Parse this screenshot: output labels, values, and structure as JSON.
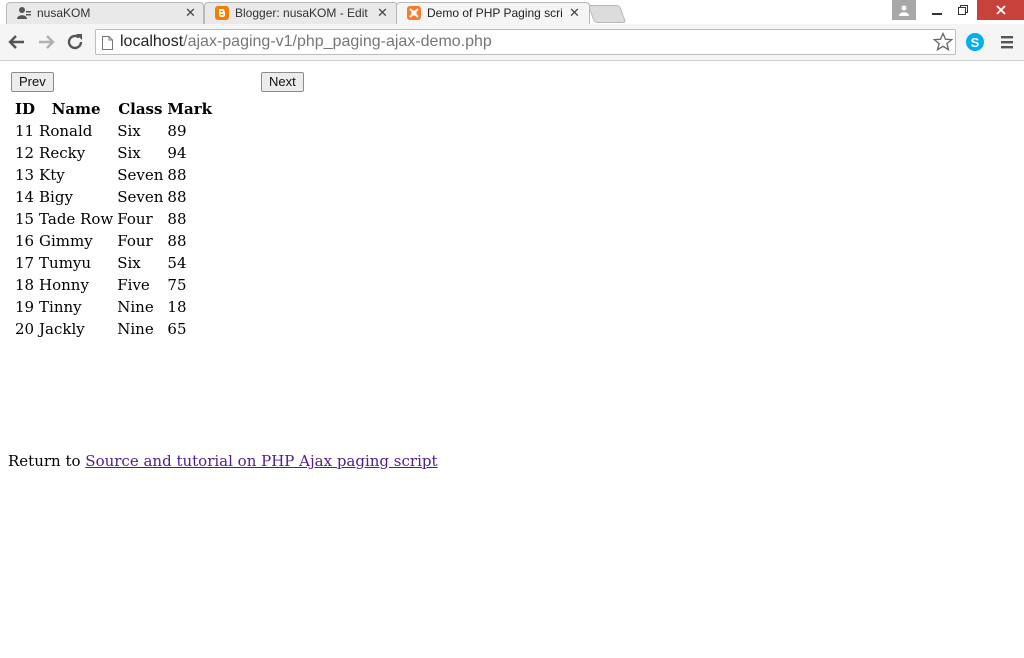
{
  "browser": {
    "tabs": [
      {
        "title": "nusaKOM",
        "icon": "user-icon"
      },
      {
        "title": "Blogger: nusaKOM - Edit e",
        "icon": "blogger-icon",
        "icon_color": "#f57d00"
      },
      {
        "title": "Demo of PHP Paging scrip",
        "icon": "xampp-icon",
        "icon_color": "#fb7a24",
        "active": true
      }
    ],
    "url_host": "localhost",
    "url_path": "/ajax-paging-v1/php_paging-ajax-demo.php"
  },
  "pager": {
    "prev_label": "Prev",
    "next_label": "Next"
  },
  "table": {
    "headers": [
      "ID",
      "Name",
      "Class",
      "Mark"
    ],
    "rows": [
      [
        "11",
        "Ronald",
        "Six",
        "89"
      ],
      [
        "12",
        "Recky",
        "Six",
        "94"
      ],
      [
        "13",
        "Kty",
        "Seven",
        "88"
      ],
      [
        "14",
        "Bigy",
        "Seven",
        "88"
      ],
      [
        "15",
        "Tade Row",
        "Four",
        "88"
      ],
      [
        "16",
        "Gimmy",
        "Four",
        "88"
      ],
      [
        "17",
        "Tumyu",
        "Six",
        "54"
      ],
      [
        "18",
        "Honny",
        "Five",
        "75"
      ],
      [
        "19",
        "Tinny",
        "Nine",
        "18"
      ],
      [
        "20",
        "Jackly",
        "Nine",
        "65"
      ]
    ]
  },
  "footer": {
    "return_text": "Return to ",
    "link_text": "Source and tutorial on PHP Ajax paging script"
  },
  "colors": {
    "link": "#551a8b",
    "close_button": "#d9534f",
    "skype": "#00aff0"
  }
}
